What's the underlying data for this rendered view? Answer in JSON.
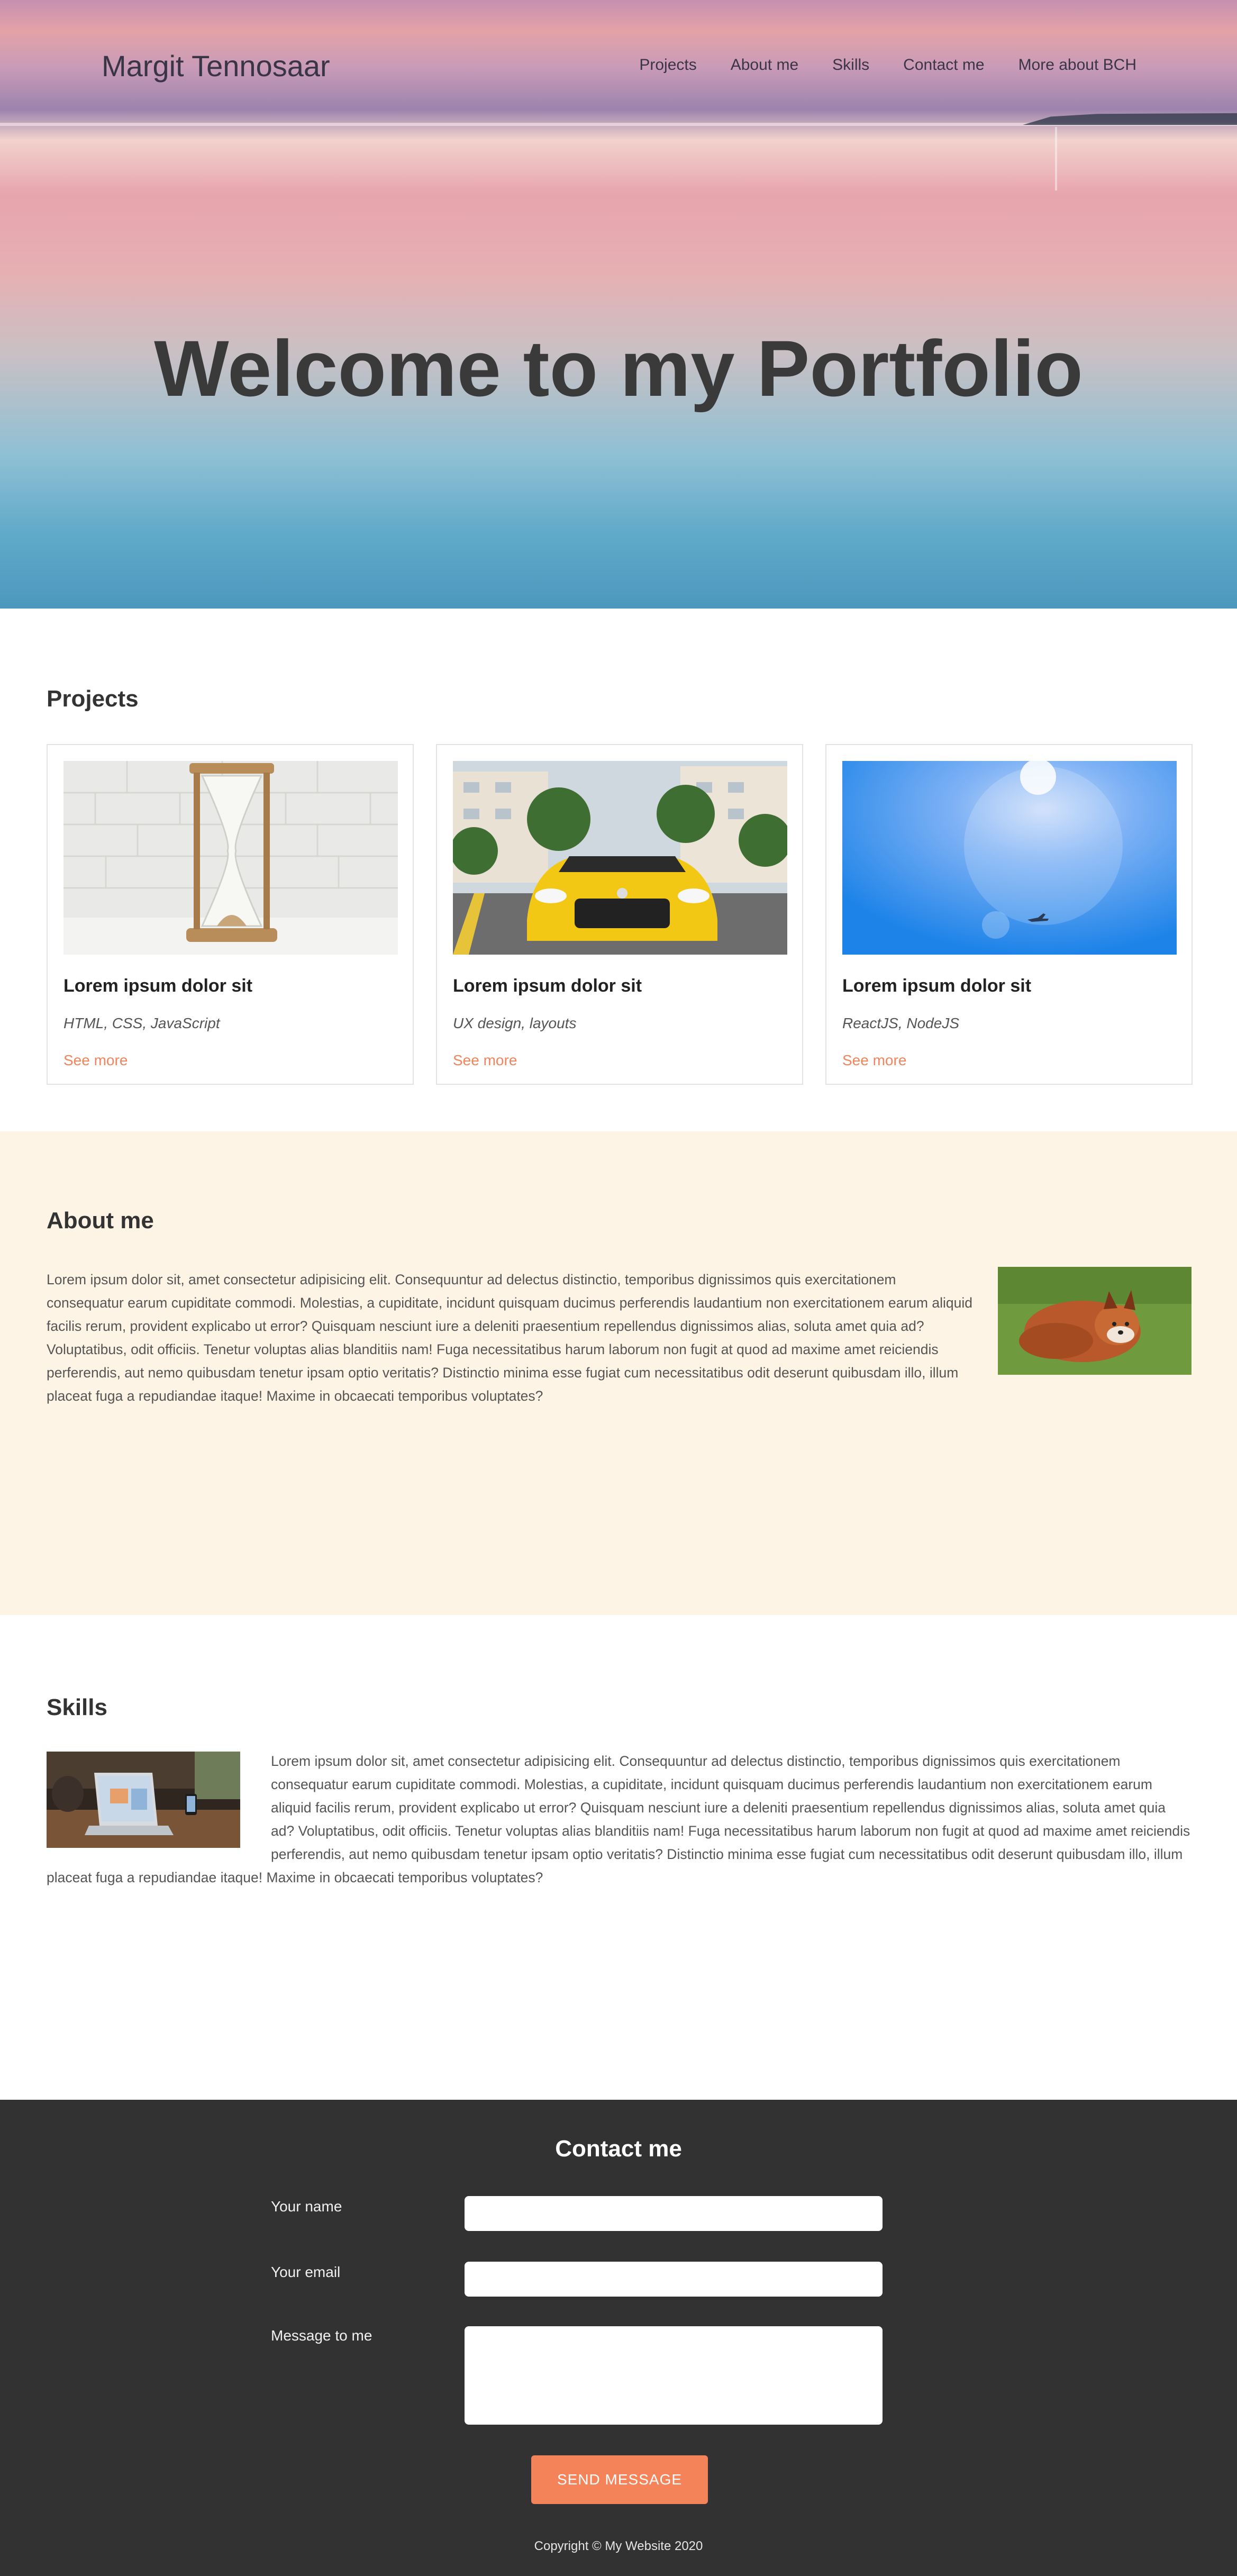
{
  "header": {
    "brand": "Margit Tennosaar",
    "nav": [
      "Projects",
      "About me",
      "Skills",
      "Contact me",
      "More about BCH"
    ]
  },
  "hero": {
    "title": "Welcome to my Portfolio"
  },
  "projects": {
    "heading": "Projects",
    "cards": [
      {
        "title": "Lorem ipsum dolor sit",
        "tags": "HTML, CSS, JavaScript",
        "link": "See more"
      },
      {
        "title": "Lorem ipsum dolor sit",
        "tags": "UX design, layouts",
        "link": "See more"
      },
      {
        "title": "Lorem ipsum dolor sit",
        "tags": "ReactJS, NodeJS",
        "link": "See more"
      }
    ]
  },
  "about": {
    "heading": "About me",
    "text": "Lorem ipsum dolor sit, amet consectetur adipisicing elit. Consequuntur ad delectus distinctio, temporibus dignissimos quis exercitationem consequatur earum cupiditate commodi. Molestias, a cupiditate, incidunt quisquam ducimus perferendis laudantium non exercitationem earum aliquid facilis rerum, provident explicabo ut error? Quisquam nesciunt iure a deleniti praesentium repellendus dignissimos alias, soluta amet quia ad? Voluptatibus, odit officiis. Tenetur voluptas alias blanditiis nam! Fuga necessitatibus harum laborum non fugit at quod ad maxime amet reiciendis perferendis, aut nemo quibusdam tenetur ipsam optio veritatis? Distinctio minima esse fugiat cum necessitatibus odit deserunt quibusdam illo, illum placeat fuga a repudiandae itaque! Maxime in obcaecati temporibus voluptates?"
  },
  "skills": {
    "heading": "Skills",
    "text": "Lorem ipsum dolor sit, amet consectetur adipisicing elit. Consequuntur ad delectus distinctio, temporibus dignissimos quis exercitationem consequatur earum cupiditate commodi. Molestias, a cupiditate, incidunt quisquam ducimus perferendis laudantium non exercitationem earum aliquid facilis rerum, provident explicabo ut error? Quisquam nesciunt iure a deleniti praesentium repellendus dignissimos alias, soluta amet quia ad? Voluptatibus, odit officiis. Tenetur voluptas alias blanditiis nam! Fuga necessitatibus harum laborum non fugit at quod ad maxime amet reiciendis perferendis, aut nemo quibusdam tenetur ipsam optio veritatis? Distinctio minima esse fugiat cum necessitatibus odit deserunt quibusdam illo, illum placeat fuga a repudiandae itaque! Maxime in obcaecati temporibus voluptates?"
  },
  "contact": {
    "heading": "Contact me",
    "name_label": "Your name",
    "email_label": "Your email",
    "message_label": "Message to me",
    "send_label": "SEND MESSAGE",
    "copyright": "Copyright © My Website 2020"
  },
  "colors": {
    "accent": "#f5835a",
    "about_bg": "#fdf4e5",
    "footer_bg": "#323232"
  }
}
